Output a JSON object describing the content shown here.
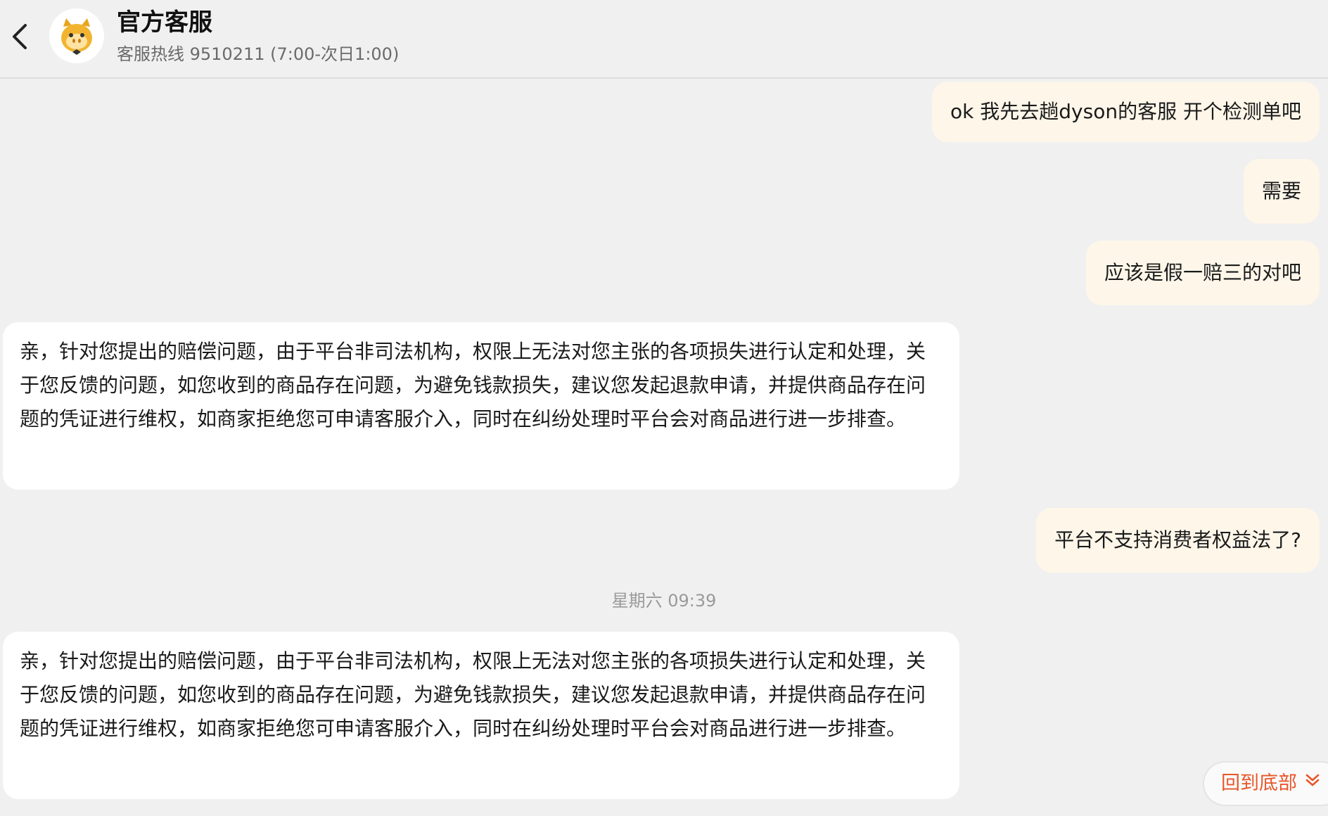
{
  "header": {
    "title": "官方客服",
    "subtitle": "客服热线 9510211 (7:00-次日1:00)"
  },
  "messages": [
    {
      "from": "me",
      "text": "ok 我先去趟dyson的客服 开个检测单吧"
    },
    {
      "from": "me",
      "text": "需要"
    },
    {
      "from": "me",
      "text": "应该是假一赔三的对吧"
    },
    {
      "from": "service",
      "text": "亲，针对您提出的赔偿问题，由于平台非司法机构，权限上无法对您主张的各项损失进行认定和处理，关于您反馈的问题，如您收到的商品存在问题，为避免钱款损失，建议您发起退款申请，并提供商品存在问题的凭证进行维权，如商家拒绝您可申请客服介入，同时在纠纷处理时平台会对商品进行进一步排查。"
    },
    {
      "from": "me",
      "text": "平台不支持消费者权益法了?"
    },
    {
      "from": "service",
      "text": "亲，针对您提出的赔偿问题，由于平台非司法机构，权限上无法对您主张的各项损失进行认定和处理，关于您反馈的问题，如您收到的商品存在问题，为避免钱款损失，建议您发起退款申请，并提供商品存在问题的凭证进行维权，如商家拒绝您可申请客服介入，同时在纠纷处理时平台会对商品进行进一步排查。"
    }
  ],
  "timestamp": "星期六 09:39",
  "scroll_to_bottom": {
    "label": "回到底部"
  },
  "colors": {
    "background": "#f0f0f0",
    "my_bubble": "#fdf6e9",
    "service_bubble": "#ffffff",
    "accent": "#e8572a"
  },
  "icons": {
    "back": "chevron-left-icon",
    "avatar": "mascot-avatar",
    "scroll_down": "double-chevron-down-icon"
  }
}
